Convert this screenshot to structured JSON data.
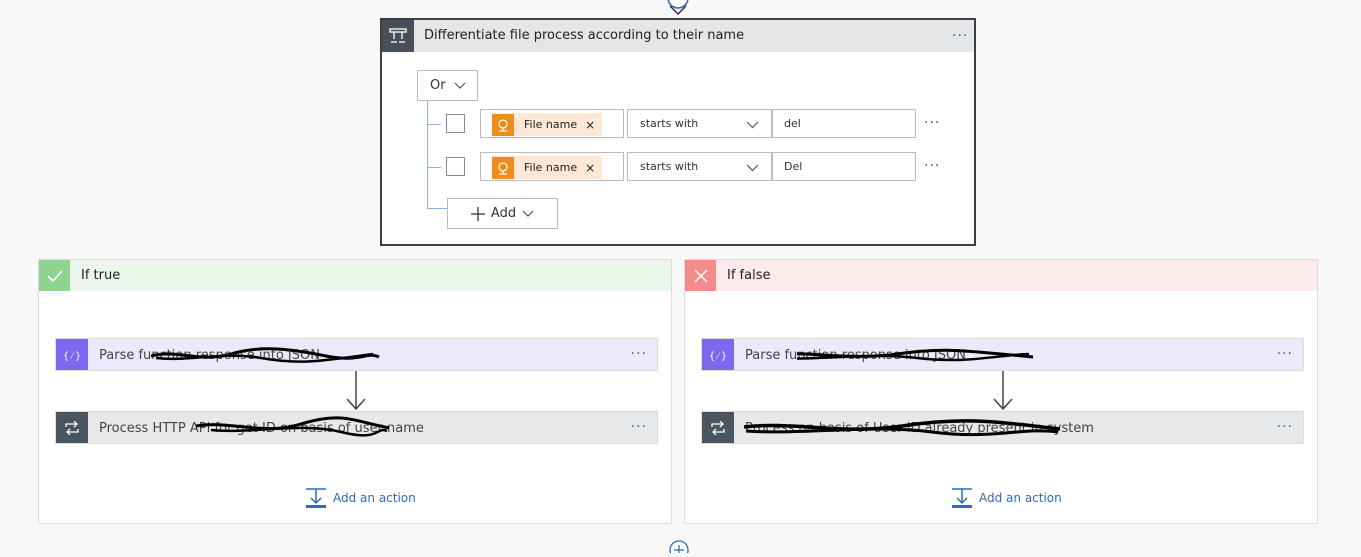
{
  "condition": {
    "title": "Differentiate file process according to their name",
    "more": "···",
    "group_operator": "Or",
    "rows": [
      {
        "token": "File name",
        "remove": "×",
        "operator": "starts with",
        "value": "del",
        "more": "···"
      },
      {
        "token": "File name",
        "remove": "×",
        "operator": "starts with",
        "value": "Del",
        "more": "···"
      }
    ],
    "add_label": "Add",
    "icon": "condition-icon"
  },
  "branches": {
    "true": {
      "title": "If true",
      "color": "#8fd58f",
      "header_bg": "#ecf7ec",
      "icon": "checkmark-icon",
      "steps": [
        {
          "label": "Parse function response into JSON",
          "icon": "parse-json-icon",
          "icon_color": "#7b68ee",
          "more": "···"
        },
        {
          "label": "Process HTTP API for get ID on basis of user name",
          "icon": "loop-icon",
          "icon_color": "#4a5560",
          "more": "···"
        }
      ],
      "add_action": "Add an action"
    },
    "false": {
      "title": "If false",
      "color": "#f38b8b",
      "header_bg": "#fdeaea",
      "icon": "close-icon",
      "steps": [
        {
          "label": "Parse function response into JSON",
          "icon": "parse-json-icon",
          "icon_color": "#7b68ee",
          "more": "···"
        },
        {
          "label": "Process on basis of User ID already present in system",
          "icon": "loop-icon",
          "icon_color": "#4a5560",
          "more": "···"
        }
      ],
      "add_action": "Add an action"
    }
  },
  "colors": {
    "accent_blue": "#2f6cb8",
    "token_orange": "#f08c1c",
    "token_bg": "#fde8d6",
    "condition_header": "#e5e6e8",
    "condition_icon_bg": "#484f58"
  }
}
